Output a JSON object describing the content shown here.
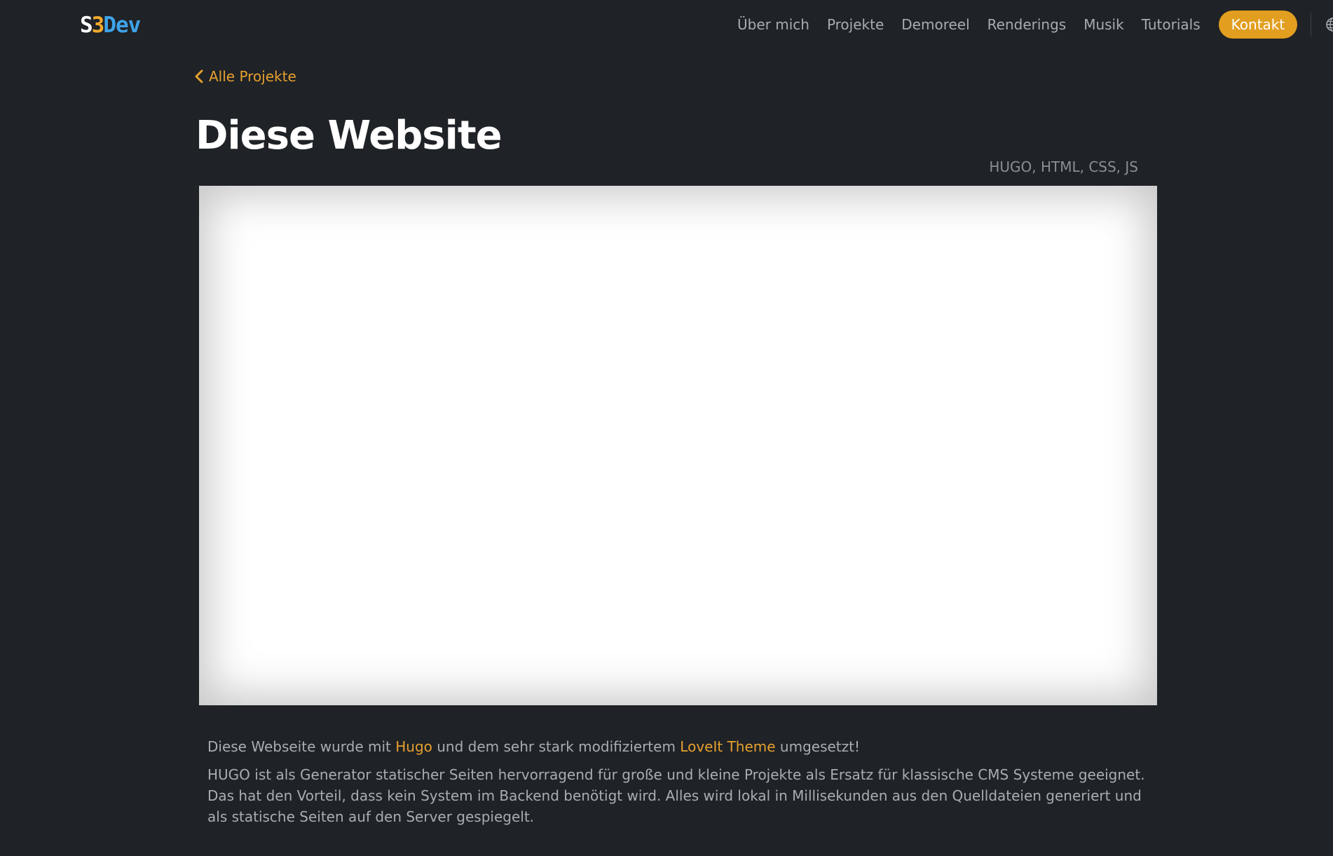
{
  "brand": {
    "logo_s": "S",
    "logo_3": "3",
    "logo_dev": "Dev"
  },
  "nav": {
    "items": [
      {
        "label": "Über mich"
      },
      {
        "label": "Projekte"
      },
      {
        "label": "Demoreel"
      },
      {
        "label": "Renderings"
      },
      {
        "label": "Musik"
      },
      {
        "label": "Tutorials"
      }
    ],
    "contact_label": "Kontakt",
    "language_icon": "globe-icon"
  },
  "page": {
    "back_label": "Alle Projekte",
    "title": "Diese Website",
    "tags": "HUGO, HTML, CSS, JS"
  },
  "content": {
    "p1_prefix": "Diese Webseite wurde mit ",
    "p1_link1": "Hugo",
    "p1_middle": " und dem sehr stark modifiziertem ",
    "p1_link2": "LoveIt Theme",
    "p1_suffix": " umgesetzt!",
    "p2": "HUGO ist als Generator statischer Seiten hervorragend für große und kleine Projekte als Ersatz für klassische CMS Systeme geeignet. Das hat den Vorteil, dass kein System im Backend benötigt wird. Alles wird lokal in Millisekunden aus den Quelldateien generiert und als statische Seiten auf den Server gespiegelt."
  },
  "colors": {
    "background": "#1f2226",
    "accent": "#e29e1f",
    "nav_text": "#a8acb2",
    "logo_blue": "#3fa3e8"
  }
}
